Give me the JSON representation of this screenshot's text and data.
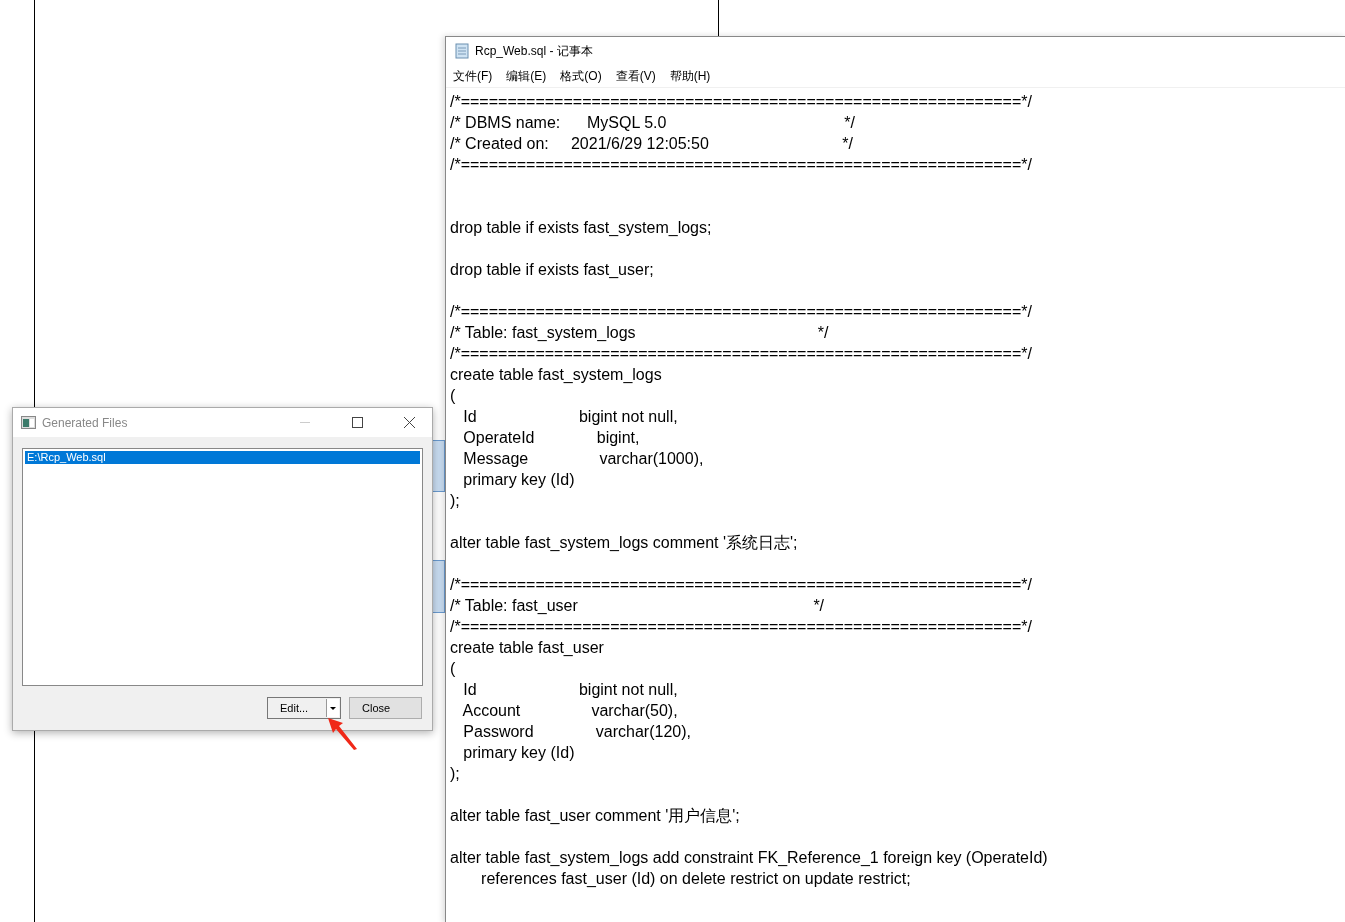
{
  "notepad": {
    "title": "Rcp_Web.sql - 记事本",
    "menu": [
      "文件(F)",
      "编辑(E)",
      "格式(O)",
      "查看(V)",
      "帮助(H)"
    ],
    "lines": [
      {
        "kind": "text",
        "text": "/*============================================================*/"
      },
      {
        "kind": "text",
        "text": "/* DBMS name:      MySQL 5.0                                        */"
      },
      {
        "kind": "text",
        "text": "/* Created on:     2021/6/29 12:05:50                              */"
      },
      {
        "kind": "text",
        "text": "/*============================================================*/"
      },
      {
        "kind": "blank"
      },
      {
        "kind": "blank"
      },
      {
        "kind": "text",
        "text": "drop table if exists fast_system_logs;"
      },
      {
        "kind": "blank"
      },
      {
        "kind": "text",
        "text": "drop table if exists fast_user;"
      },
      {
        "kind": "blank"
      },
      {
        "kind": "text",
        "text": "/*============================================================*/"
      },
      {
        "kind": "text",
        "text": "/* Table: fast_system_logs                                         */"
      },
      {
        "kind": "text",
        "text": "/*============================================================*/"
      },
      {
        "kind": "text",
        "text": "create table fast_system_logs"
      },
      {
        "kind": "text",
        "text": "("
      },
      {
        "kind": "text",
        "text": "   Id                       bigint not null,"
      },
      {
        "kind": "text",
        "text": "   OperateId              bigint,"
      },
      {
        "kind": "text",
        "text": "   Message                varchar(1000),"
      },
      {
        "kind": "text",
        "text": "   primary key (Id)"
      },
      {
        "kind": "text",
        "text": ");"
      },
      {
        "kind": "blank"
      },
      {
        "kind": "text",
        "text": "alter table fast_system_logs comment '系统日志';"
      },
      {
        "kind": "blank"
      },
      {
        "kind": "text",
        "text": "/*============================================================*/"
      },
      {
        "kind": "text",
        "text": "/* Table: fast_user                                                     */"
      },
      {
        "kind": "text",
        "text": "/*============================================================*/"
      },
      {
        "kind": "text",
        "text": "create table fast_user"
      },
      {
        "kind": "text",
        "text": "("
      },
      {
        "kind": "text",
        "text": "   Id                       bigint not null,"
      },
      {
        "kind": "text",
        "text": "   Account                varchar(50),"
      },
      {
        "kind": "text",
        "text": "   Password              varchar(120),"
      },
      {
        "kind": "text",
        "text": "   primary key (Id)"
      },
      {
        "kind": "text",
        "text": ");"
      },
      {
        "kind": "blank"
      },
      {
        "kind": "text",
        "text": "alter table fast_user comment '用户信息';"
      },
      {
        "kind": "blank"
      },
      {
        "kind": "text",
        "text": "alter table fast_system_logs add constraint FK_Reference_1 foreign key (OperateId)"
      },
      {
        "kind": "text",
        "text": "       references fast_user (Id) on delete restrict on update restrict;"
      }
    ]
  },
  "dialog": {
    "title": "Generated Files",
    "files": [
      {
        "path": "E:\\Rcp_Web.sql",
        "selected": true
      }
    ],
    "buttons": [
      {
        "kind": "split",
        "label": "Edit..."
      },
      {
        "kind": "plain",
        "label": "Close"
      }
    ]
  }
}
